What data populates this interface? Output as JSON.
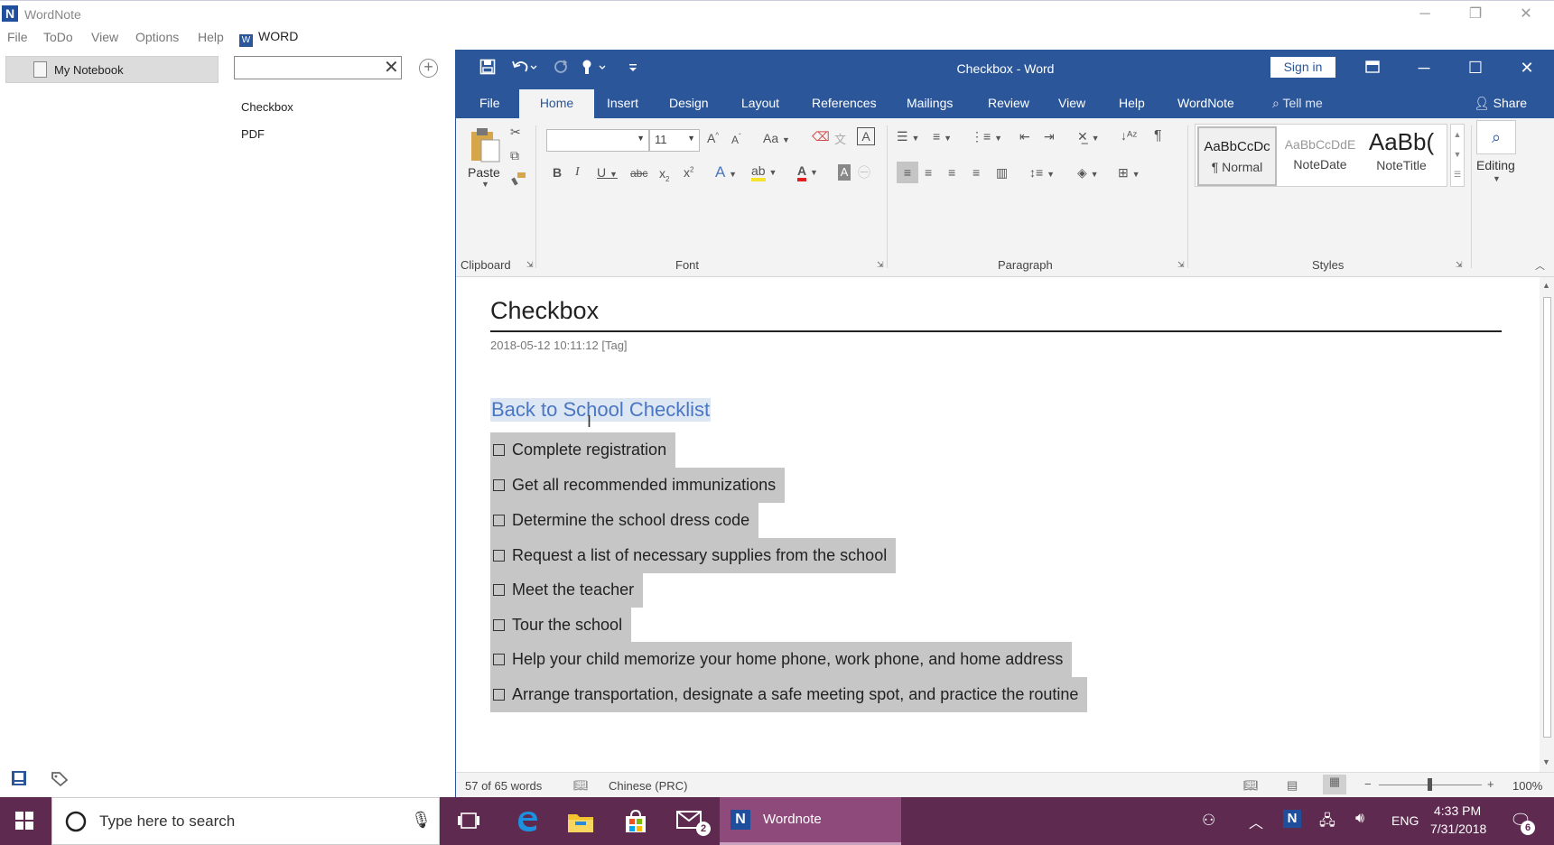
{
  "outer_app": {
    "title": "WordNote",
    "logo_letter": "N",
    "menu": [
      "File",
      "ToDo",
      "View",
      "Options",
      "Help"
    ],
    "word_badge": "WORD",
    "notebook": "My Notebook",
    "search_value": "",
    "notes": [
      "Checkbox",
      "PDF"
    ]
  },
  "word": {
    "title": "Checkbox  -  Word",
    "sign_in": "Sign in",
    "tabs": [
      "File",
      "Home",
      "Insert",
      "Design",
      "Layout",
      "References",
      "Mailings",
      "Review",
      "View",
      "Help",
      "WordNote"
    ],
    "tell_me": "Tell me",
    "share": "Share",
    "ribbon": {
      "paste": "Paste",
      "font_name": "",
      "font_size": "11",
      "groups": [
        "Clipboard",
        "Font",
        "Paragraph",
        "Styles"
      ],
      "styles": [
        {
          "preview": "AaBbCcDc",
          "name": "¶ Normal"
        },
        {
          "preview": "AaBbCcDdE",
          "name": "NoteDate"
        },
        {
          "preview": "AaBb(",
          "name": "NoteTitle"
        }
      ],
      "editing": "Editing"
    },
    "document": {
      "title": "Checkbox",
      "meta": "2018-05-12 10:11:12  [Tag]",
      "heading": "Back to School Checklist",
      "items": [
        "Complete registration",
        "Get all recommended immunizations",
        "Determine the school dress code",
        "Request a list of necessary supplies from the school",
        "Meet the teacher",
        "Tour the school",
        "Help your child memorize your home phone, work phone, and home address",
        "Arrange transportation, designate a safe meeting spot, and practice the routine"
      ]
    },
    "status": {
      "words": "57 of 65 words",
      "language": "Chinese (PRC)",
      "zoom": "100%"
    }
  },
  "taskbar": {
    "search_placeholder": "Type here to search",
    "wordnote_label": "Wordnote",
    "mail_badge": "2",
    "notif_badge": "6",
    "lang": "ENG",
    "time": "4:33 PM",
    "date": "7/31/2018"
  },
  "colors": {
    "word_blue": "#2b579a",
    "taskbar": "#5e2a4f",
    "selection": "#c6c6c6",
    "heading": "#4a76c2"
  }
}
